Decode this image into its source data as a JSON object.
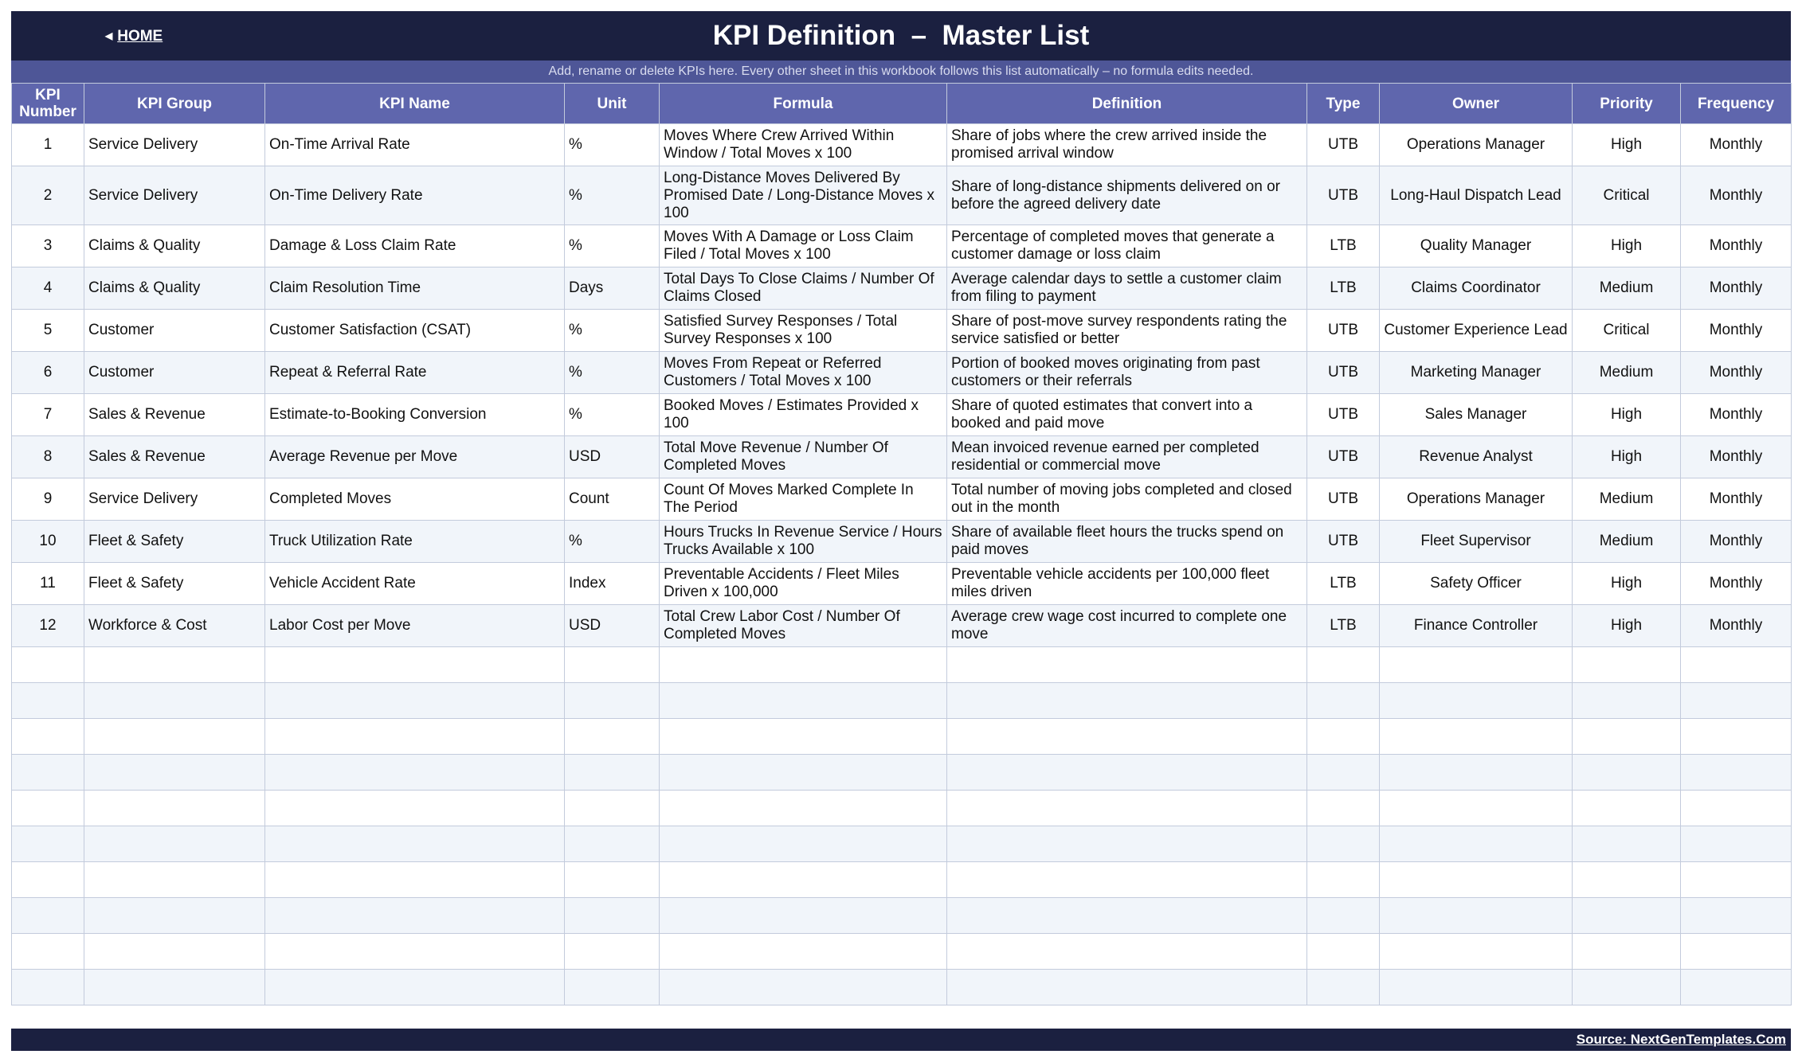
{
  "header": {
    "home_label": "HOME",
    "title": "KPI Definition  –  Master List",
    "subtitle": "Add, rename or delete KPIs here. Every other sheet in this workbook follows this list automatically – no formula edits needed."
  },
  "table": {
    "columns": [
      "KPI Number",
      "KPI Group",
      "KPI Name",
      "Unit",
      "Formula",
      "Definition",
      "Type",
      "Owner",
      "Priority",
      "Frequency"
    ],
    "rows": [
      [
        "1",
        "Service Delivery",
        "On-Time Arrival Rate",
        "%",
        "Moves Where Crew Arrived Within Window / Total Moves x 100",
        "Share of jobs where the crew arrived inside the promised arrival window",
        "UTB",
        "Operations Manager",
        "High",
        "Monthly"
      ],
      [
        "2",
        "Service Delivery",
        "On-Time Delivery Rate",
        "%",
        "Long-Distance Moves Delivered By Promised Date / Long-Distance Moves x 100",
        "Share of long-distance shipments delivered on or before the agreed delivery date",
        "UTB",
        "Long-Haul Dispatch Lead",
        "Critical",
        "Monthly"
      ],
      [
        "3",
        "Claims & Quality",
        "Damage & Loss Claim Rate",
        "%",
        "Moves With A Damage or Loss Claim Filed / Total Moves x 100",
        "Percentage of completed moves that generate a customer damage or loss claim",
        "LTB",
        "Quality Manager",
        "High",
        "Monthly"
      ],
      [
        "4",
        "Claims & Quality",
        "Claim Resolution Time",
        "Days",
        "Total Days To Close Claims / Number Of Claims Closed",
        "Average calendar days to settle a customer claim from filing to payment",
        "LTB",
        "Claims Coordinator",
        "Medium",
        "Monthly"
      ],
      [
        "5",
        "Customer",
        "Customer Satisfaction (CSAT)",
        "%",
        "Satisfied Survey Responses / Total Survey Responses x 100",
        "Share of post-move survey respondents rating the service satisfied or better",
        "UTB",
        "Customer Experience Lead",
        "Critical",
        "Monthly"
      ],
      [
        "6",
        "Customer",
        "Repeat & Referral Rate",
        "%",
        "Moves From Repeat or Referred Customers / Total Moves x 100",
        "Portion of booked moves originating from past customers or their referrals",
        "UTB",
        "Marketing Manager",
        "Medium",
        "Monthly"
      ],
      [
        "7",
        "Sales & Revenue",
        "Estimate-to-Booking Conversion",
        "%",
        "Booked Moves / Estimates Provided x 100",
        "Share of quoted estimates that convert into a booked and paid move",
        "UTB",
        "Sales Manager",
        "High",
        "Monthly"
      ],
      [
        "8",
        "Sales & Revenue",
        "Average Revenue per Move",
        "USD",
        "Total Move Revenue / Number Of Completed Moves",
        "Mean invoiced revenue earned per completed residential or commercial move",
        "UTB",
        "Revenue Analyst",
        "High",
        "Monthly"
      ],
      [
        "9",
        "Service Delivery",
        "Completed Moves",
        "Count",
        "Count Of Moves Marked Complete In The Period",
        "Total number of moving jobs completed and closed out in the month",
        "UTB",
        "Operations Manager",
        "Medium",
        "Monthly"
      ],
      [
        "10",
        "Fleet & Safety",
        "Truck Utilization Rate",
        "%",
        "Hours Trucks In Revenue Service / Hours Trucks Available x 100",
        "Share of available fleet hours the trucks spend on paid moves",
        "UTB",
        "Fleet Supervisor",
        "Medium",
        "Monthly"
      ],
      [
        "11",
        "Fleet & Safety",
        "Vehicle Accident Rate",
        "Index",
        "Preventable Accidents / Fleet Miles Driven x 100,000",
        "Preventable vehicle accidents per 100,000 fleet miles driven",
        "LTB",
        "Safety Officer",
        "High",
        "Monthly"
      ],
      [
        "12",
        "Workforce & Cost",
        "Labor Cost per Move",
        "USD",
        "Total Crew Labor Cost / Number Of Completed Moves",
        "Average crew wage cost incurred to complete one move",
        "LTB",
        "Finance Controller",
        "High",
        "Monthly"
      ]
    ],
    "empty_rows": 10
  },
  "footer": {
    "source": "Source: NextGenTemplates.Com"
  },
  "colors": {
    "header_bg": "#1b2040",
    "subtitle_bg": "#4e5697",
    "column_header_bg": "#5f66ad",
    "row_alt_bg": "#f1f5fa",
    "grid_line": "#c3cbdc"
  },
  "icons": {
    "home": "back-triangle-icon"
  }
}
